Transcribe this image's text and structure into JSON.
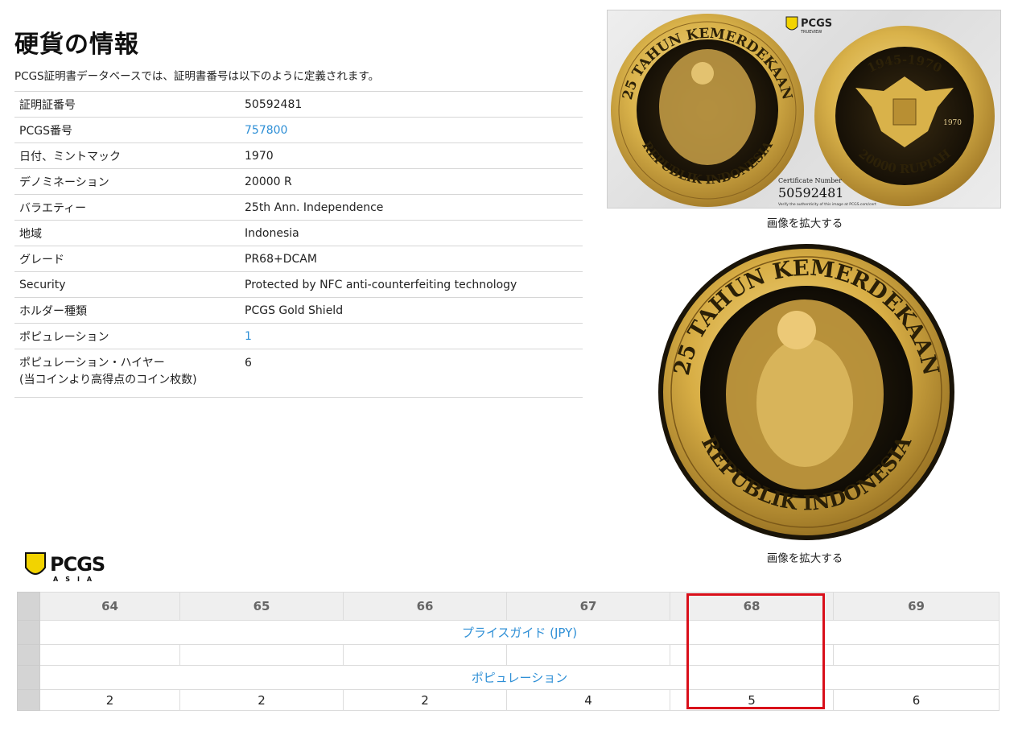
{
  "page": {
    "title": "硬貨の情報",
    "intro": "PCGS証明書データベースでは、証明書番号は以下のように定義されます。"
  },
  "info_rows": [
    {
      "label": "証明証番号",
      "value": "50592481"
    },
    {
      "label": "PCGS番号",
      "value": "757800"
    },
    {
      "label": "日付、ミントマック",
      "value": "1970"
    },
    {
      "label": "デノミネーション",
      "value": "20000 R"
    },
    {
      "label": "バラエティー",
      "value": "25th Ann. Independence"
    },
    {
      "label": "地域",
      "value": "Indonesia"
    },
    {
      "label": "グレード",
      "value": "PR68+DCAM"
    },
    {
      "label": "Security",
      "value": "Protected by NFC anti-counterfeiting technology"
    },
    {
      "label": "ホルダー種類",
      "value": "PCGS Gold Shield"
    },
    {
      "label": "ポピュレーション",
      "value": "1"
    },
    {
      "label": "ポピュレーション・ハイヤー",
      "label2": "(当コインより高得点のコイン枚数)",
      "value": "6"
    }
  ],
  "images": {
    "caption_slab": "画像を拡大する",
    "caption_coin": "画像を拡大する",
    "obverse_top_legend": "25 TAHUN KEMERDEKAAN",
    "obverse_bottom_legend": "REPUBLIK INDONESIA",
    "reverse_years": "1945-1970",
    "reverse_denomination": "20000 RUPIAH",
    "reverse_year": "1970",
    "cert_label": "Certificate Number",
    "cert_number": "50592481",
    "verify_text": "Verify the authenticity of this image at PCGS.com/cert",
    "pcgs_badge": "PCGS",
    "pcgs_badge_sub": "TRUEVIEW"
  },
  "logo": {
    "main": "PCGS",
    "sub": "ASIA"
  },
  "grade_table": {
    "grades": [
      "64",
      "65",
      "66",
      "67",
      "68",
      "69"
    ],
    "price_guide_label": "プライスガイド (JPY)",
    "population_label": "ポピュレーション",
    "populations": [
      "2",
      "2",
      "2",
      "4",
      "5",
      "6"
    ],
    "highlighted_grade": "68"
  },
  "colors": {
    "link": "#2e8fd6",
    "highlight": "#d90f1a",
    "gold": "#d9b24a",
    "logo_yellow": "#f2d300"
  }
}
